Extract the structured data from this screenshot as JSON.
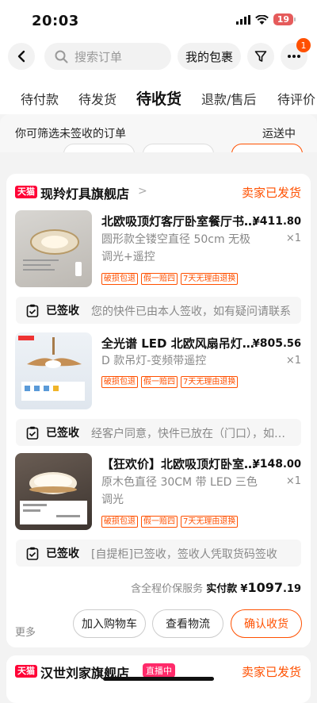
{
  "status_bar": {
    "time": "20:03",
    "battery": "19"
  },
  "header": {
    "search_placeholder": "搜索订单",
    "my_packages": "我的包裹",
    "more_badge": "1"
  },
  "tabs": [
    {
      "label": "待付款"
    },
    {
      "label": "待发货"
    },
    {
      "label": "待收货"
    },
    {
      "label": "退款/售后"
    },
    {
      "label": "待评价"
    }
  ],
  "filter": {
    "hint": "你可筛选未签收的订单",
    "status": "运送中"
  },
  "order": {
    "store_tag": "天猫",
    "store_name": "现羚灯具旗舰店",
    "status": "卖家已发货",
    "items": [
      {
        "title": "北欧吸顶灯客厅卧室餐厅书房灯",
        "price_symbol": "¥",
        "price_int": "411",
        "price_dec": ".80",
        "sku": "圆形款全镂空直径 50cm 无极调光+遥控",
        "qty": "×1",
        "tags": [
          "破损包退",
          "假一赔四",
          "7天无理由退换"
        ],
        "sign_title": "已签收",
        "sign_desc": "您的快件已由本人签收，如有疑问请联系"
      },
      {
        "title": "全光谱 LED 北欧风扇吊灯客厅",
        "price_symbol": "¥",
        "price_int": "805",
        "price_dec": ".56",
        "sku": "D 款吊灯-变频带遥控",
        "qty": "×1",
        "tags": [
          "破损包退",
          "假一赔四",
          "7天无理由退换"
        ],
        "sign_title": "已签收",
        "sign_desc": "经客户同意，快件已放在（门口），如有疑问"
      },
      {
        "title": "【狂欢价】北欧吸顶灯卧室灯具",
        "price_symbol": "¥",
        "price_int": "148",
        "price_dec": ".00",
        "sku": "原木色直径 30CM 带 LED 三色调光",
        "qty": "×1",
        "tags": [
          "破损包退",
          "假一赔四",
          "7天无理由退换"
        ],
        "sign_title": "已签收",
        "sign_desc": "[自提柜]已签收，签收人凭取货码签收"
      }
    ],
    "total_prefix": "含全程价保服务",
    "total_label": "实付款",
    "total_symbol": "¥",
    "total_int": "1097",
    "total_dec": ".19",
    "more": "更多",
    "buttons": {
      "add_cart": "加入购物车",
      "logistics": "查看物流",
      "confirm": "确认收货"
    }
  },
  "next_order": {
    "store_tag": "天猫",
    "store_name": "汉世刘家旗舰店",
    "live": "直播中",
    "status": "卖家已发货"
  }
}
